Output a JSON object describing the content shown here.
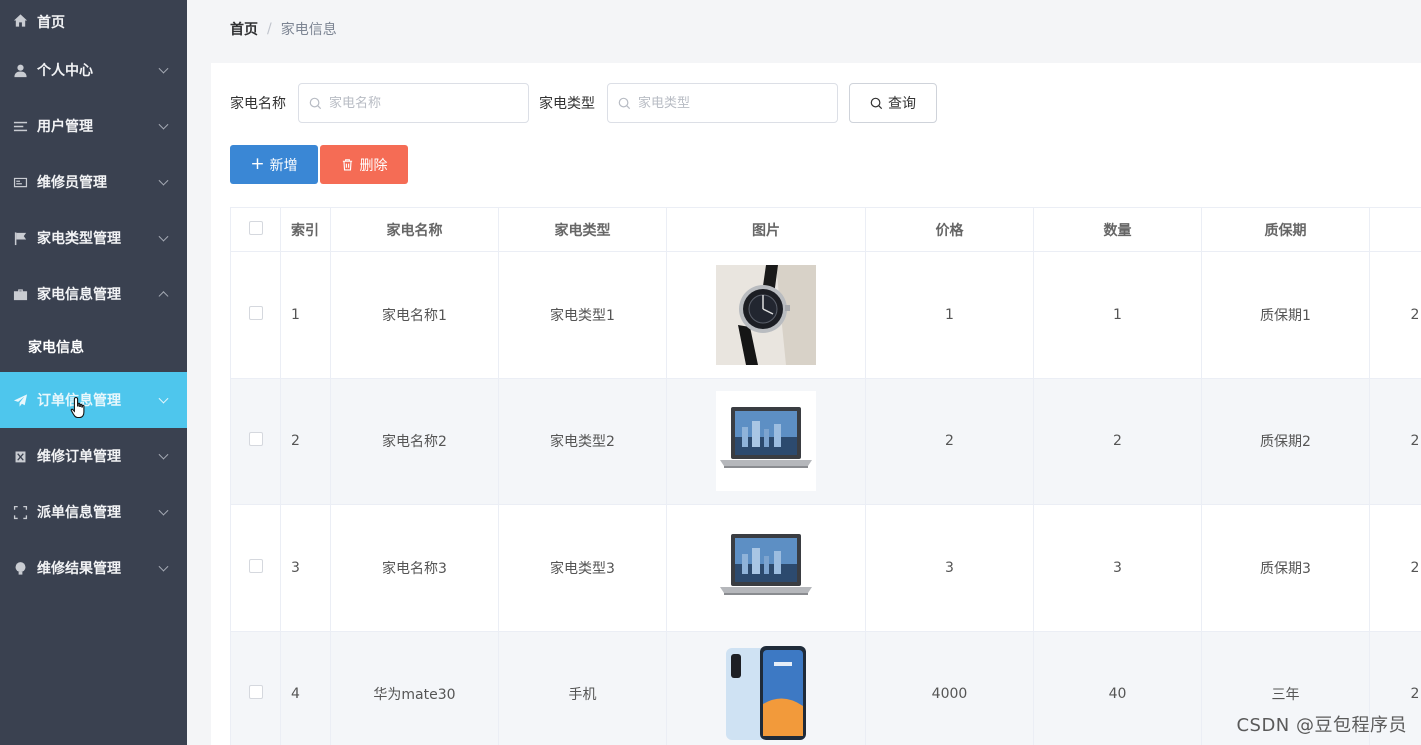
{
  "sidebar": {
    "items": [
      {
        "label": "首页",
        "icon": "home-icon"
      },
      {
        "label": "个人中心",
        "icon": "user-icon"
      },
      {
        "label": "用户管理",
        "icon": "list-icon"
      },
      {
        "label": "维修员管理",
        "icon": "id-card-icon"
      },
      {
        "label": "家电类型管理",
        "icon": "flag-icon"
      },
      {
        "label": "家电信息管理",
        "icon": "briefcase-icon",
        "expanded": true
      },
      {
        "label": "订单信息管理",
        "icon": "paper-plane-icon",
        "active": true
      },
      {
        "label": "维修订单管理",
        "icon": "clipboard-icon"
      },
      {
        "label": "派单信息管理",
        "icon": "frame-icon"
      },
      {
        "label": "维修结果管理",
        "icon": "bulb-icon"
      }
    ],
    "submenu_label": "家电信息",
    "active_color": "#4ec6ed",
    "background": "#3a4150"
  },
  "breadcrumb": {
    "home": "首页",
    "separator": "/",
    "current": "家电信息"
  },
  "search": {
    "name_label": "家电名称",
    "name_placeholder": "家电名称",
    "type_label": "家电类型",
    "type_placeholder": "家电类型",
    "query_label": "查询"
  },
  "actions": {
    "add_label": "新增",
    "add_color": "#3a87d5",
    "delete_label": "删除",
    "delete_color": "#f56c55"
  },
  "table": {
    "headers": [
      "索引",
      "家电名称",
      "家电类型",
      "图片",
      "价格",
      "数量",
      "质保期"
    ],
    "rows": [
      {
        "index": "1",
        "name": "家电名称1",
        "type": "家电类型1",
        "image": "watch",
        "price": "1",
        "quantity": "1",
        "warranty": "质保期1",
        "extra": "2"
      },
      {
        "index": "2",
        "name": "家电名称2",
        "type": "家电类型2",
        "image": "laptop",
        "price": "2",
        "quantity": "2",
        "warranty": "质保期2",
        "extra": "2"
      },
      {
        "index": "3",
        "name": "家电名称3",
        "type": "家电类型3",
        "image": "laptop",
        "price": "3",
        "quantity": "3",
        "warranty": "质保期3",
        "extra": "2"
      },
      {
        "index": "4",
        "name": "华为mate30",
        "type": "手机",
        "image": "phone",
        "price": "4000",
        "quantity": "40",
        "warranty": "三年",
        "extra": "2"
      }
    ]
  },
  "watermark": "CSDN @豆包程序员"
}
